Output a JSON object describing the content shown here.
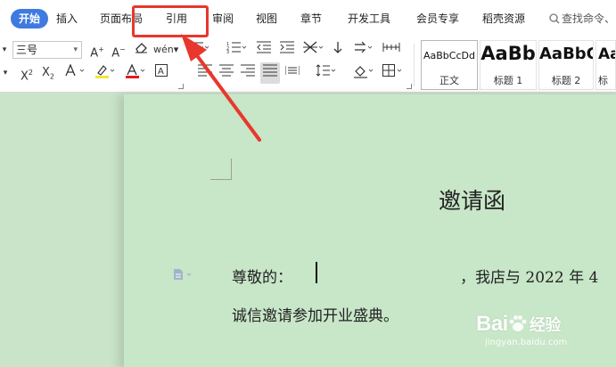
{
  "tabs": [
    {
      "id": "home",
      "label": "开始",
      "active": true
    },
    {
      "id": "insert",
      "label": "插入"
    },
    {
      "id": "page_layout",
      "label": "页面布局"
    },
    {
      "id": "references",
      "label": "引用"
    },
    {
      "id": "review",
      "label": "审阅"
    },
    {
      "id": "view",
      "label": "视图"
    },
    {
      "id": "chapter",
      "label": "章节"
    },
    {
      "id": "developer",
      "label": "开发工具"
    },
    {
      "id": "member",
      "label": "会员专享"
    },
    {
      "id": "docer",
      "label": "稻壳资源"
    }
  ],
  "search": {
    "placeholder": "查找命令、"
  },
  "toolbar": {
    "font_size_value": "三号",
    "icons": [
      "font-grow-icon",
      "font-shrink-icon",
      "clear-format-icon",
      "phonetic-guide-icon",
      "bullets-icon",
      "numbering-icon",
      "outdent-icon",
      "indent-icon",
      "chinese-layout-icon",
      "sort-icon",
      "text-direction-icon",
      "show-marks-icon",
      "superscript-icon",
      "subscript-icon",
      "text-effect-icon",
      "highlight-icon",
      "font-color-icon",
      "char-border-icon",
      "align-left-icon",
      "align-center-icon",
      "align-right-icon",
      "justify-icon",
      "distribute-icon",
      "line-spacing-icon",
      "shading-icon",
      "borders-icon"
    ],
    "colors": {
      "highlight": "#f5e53a",
      "font_color": "#e11d1d"
    }
  },
  "styles": [
    {
      "sample": "AaBbCcDd",
      "name": "正文"
    },
    {
      "sample": "AaBb",
      "name": "标题 1"
    },
    {
      "sample": "AaBbC",
      "name": "标题 2"
    },
    {
      "sample": "Aa",
      "name": "标"
    }
  ],
  "document": {
    "title": "邀请函",
    "line1_label": "尊敬的：",
    "line1_rest": "，我店与 2022 年 4",
    "line2": "诚信邀请参加开业盛典。"
  },
  "watermark": {
    "brand": "Bai",
    "brand_suffix": "du",
    "cn": "经验",
    "url": "jingyan.baidu.com"
  },
  "colors": {
    "accent": "#3f7ae0",
    "annotation": "#e8372d",
    "doc_background": "#c8e6c8"
  }
}
